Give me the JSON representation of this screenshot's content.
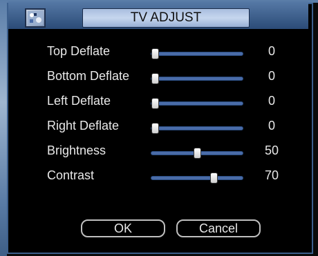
{
  "dialog": {
    "title": "TV ADJUST"
  },
  "settings": [
    {
      "label": "Top Deflate",
      "value": "0",
      "level": 0
    },
    {
      "label": "Bottom Deflate",
      "value": "0",
      "level": 0
    },
    {
      "label": "Left Deflate",
      "value": "0",
      "level": 0
    },
    {
      "label": "Right Deflate",
      "value": "0",
      "level": 0
    },
    {
      "label": "Brightness",
      "value": "50",
      "level": 0.5
    },
    {
      "label": "Contrast",
      "value": "70",
      "level": 0.7
    }
  ],
  "buttons": {
    "ok_label": "OK",
    "cancel_label": "Cancel"
  },
  "colors": {
    "title_bar": "#3c5f8d",
    "slider_track": "#4a6ca8",
    "background": "#000000"
  },
  "icons": {
    "app": "tv-adjust-app-icon"
  }
}
